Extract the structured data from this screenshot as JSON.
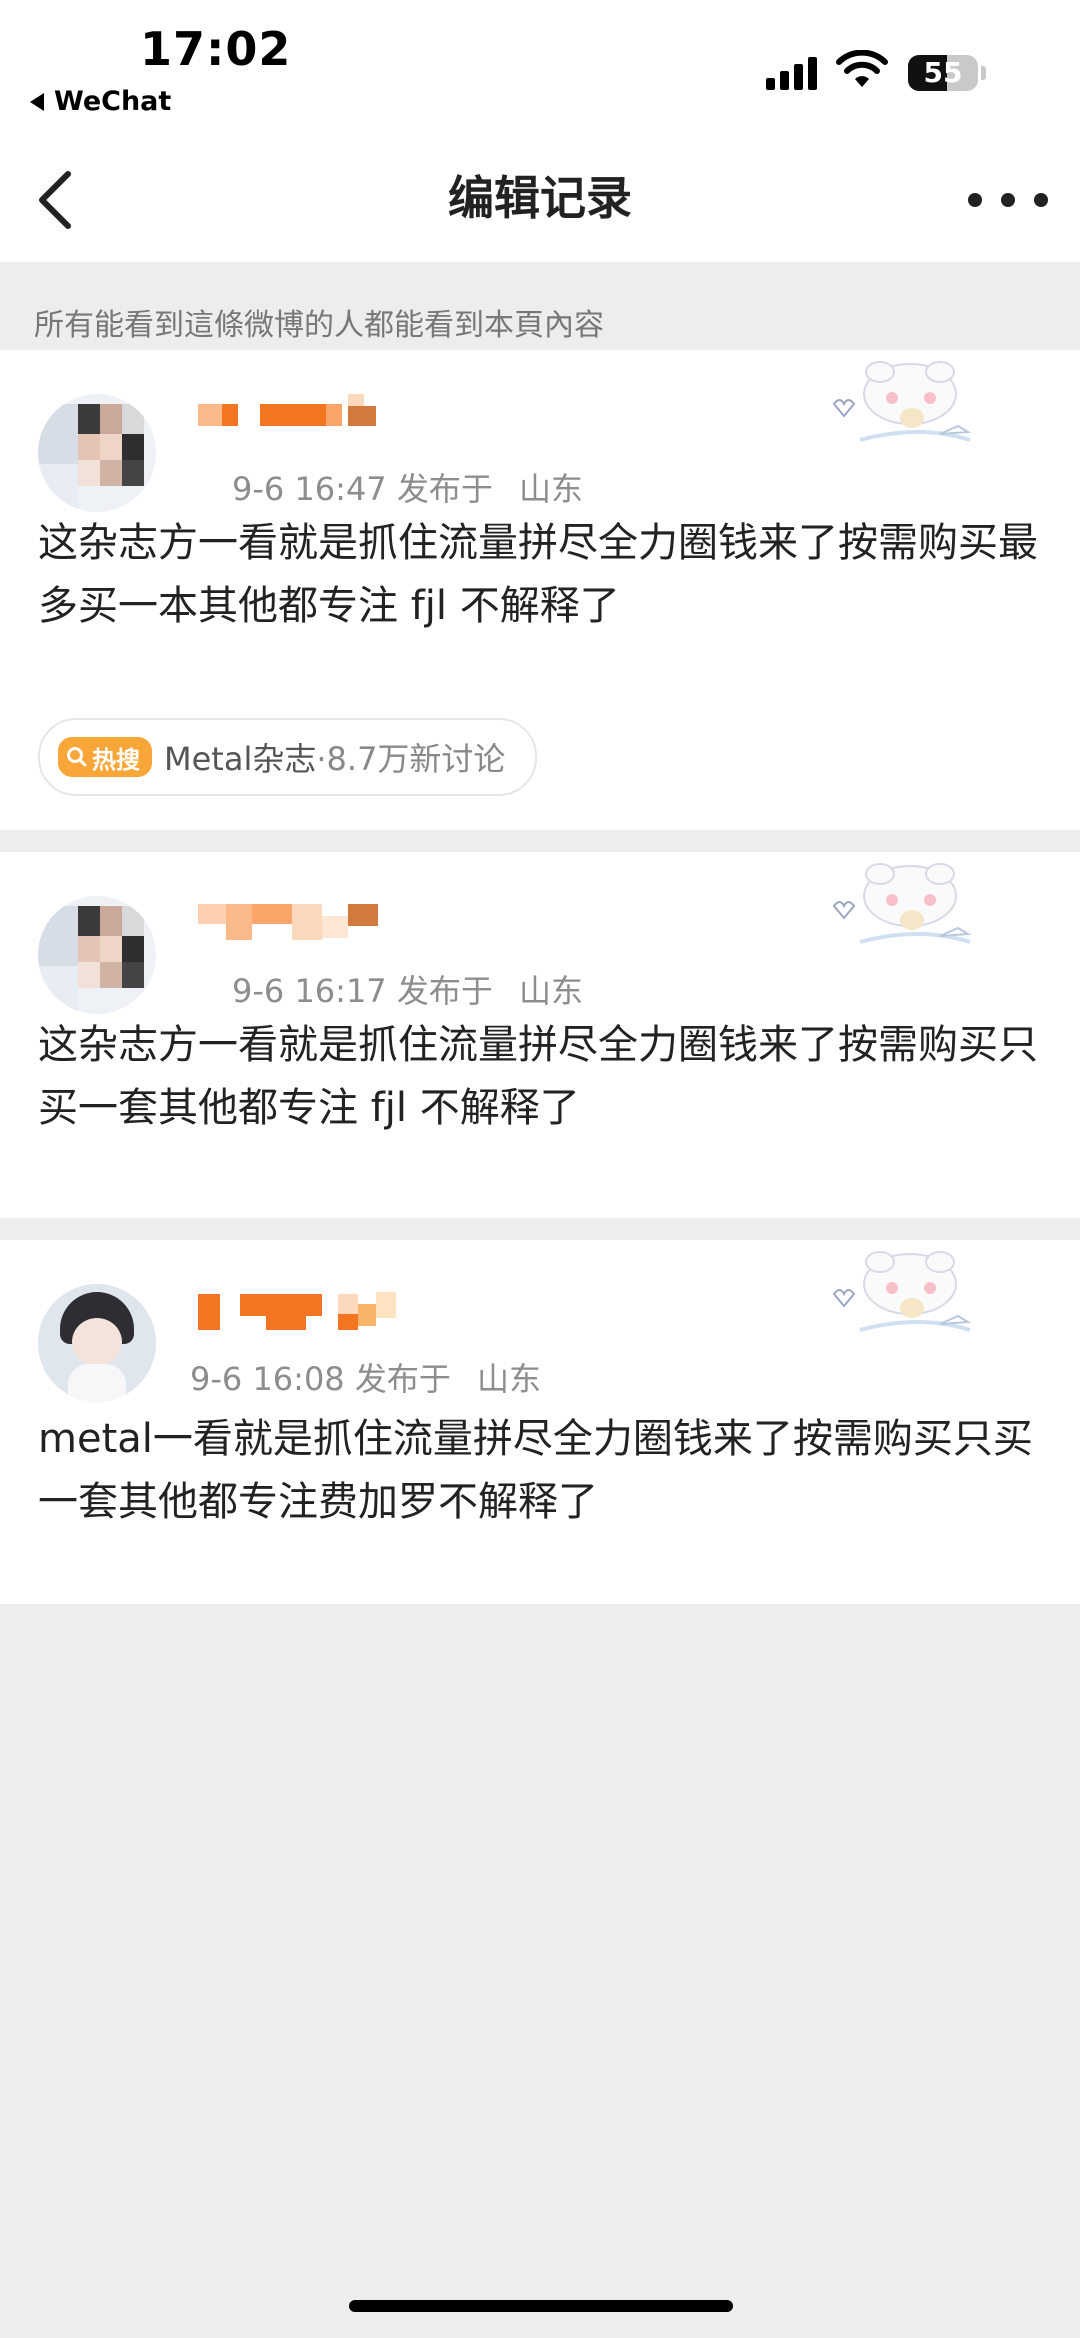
{
  "status_bar": {
    "time": "17:02",
    "back_app": "WeChat",
    "battery_level": "55",
    "battery_fraction": 0.55
  },
  "nav": {
    "title": "编辑记录"
  },
  "notice": "所有能看到這條微博的人都能看到本頁內容",
  "posts": [
    {
      "time": "9-6 16:47",
      "source": "发布于",
      "location": "山东",
      "content": "这杂志方一看就是抓住流量拼尽全力圈钱来了按需购买最多买一本其他都专注 fjl 不解释了",
      "topic": {
        "badge": "热搜",
        "name": "Metal杂志",
        "count": "·8.7万新讨论"
      }
    },
    {
      "time": "9-6 16:17",
      "source": "发布于",
      "location": "山东",
      "content": "这杂志方一看就是抓住流量拼尽全力圈钱来了按需购买只买一套其他都专注 fjl 不解释了"
    },
    {
      "time": "9-6 16:08",
      "source": "发布于",
      "location": "山东",
      "content": "metal一看就是抓住流量拼尽全力圈钱来了按需购买只买一套其他都专注费加罗不解释了"
    }
  ],
  "colors": {
    "background": "#ededed",
    "card": "#ffffff",
    "hot_badge": "#f8a638",
    "mosaic_orange": "#f37521"
  },
  "icons": {
    "back": "chevron-left-icon",
    "more": "more-dots-icon",
    "hot": "search-icon",
    "sticker": "bear-sticker-icon"
  }
}
